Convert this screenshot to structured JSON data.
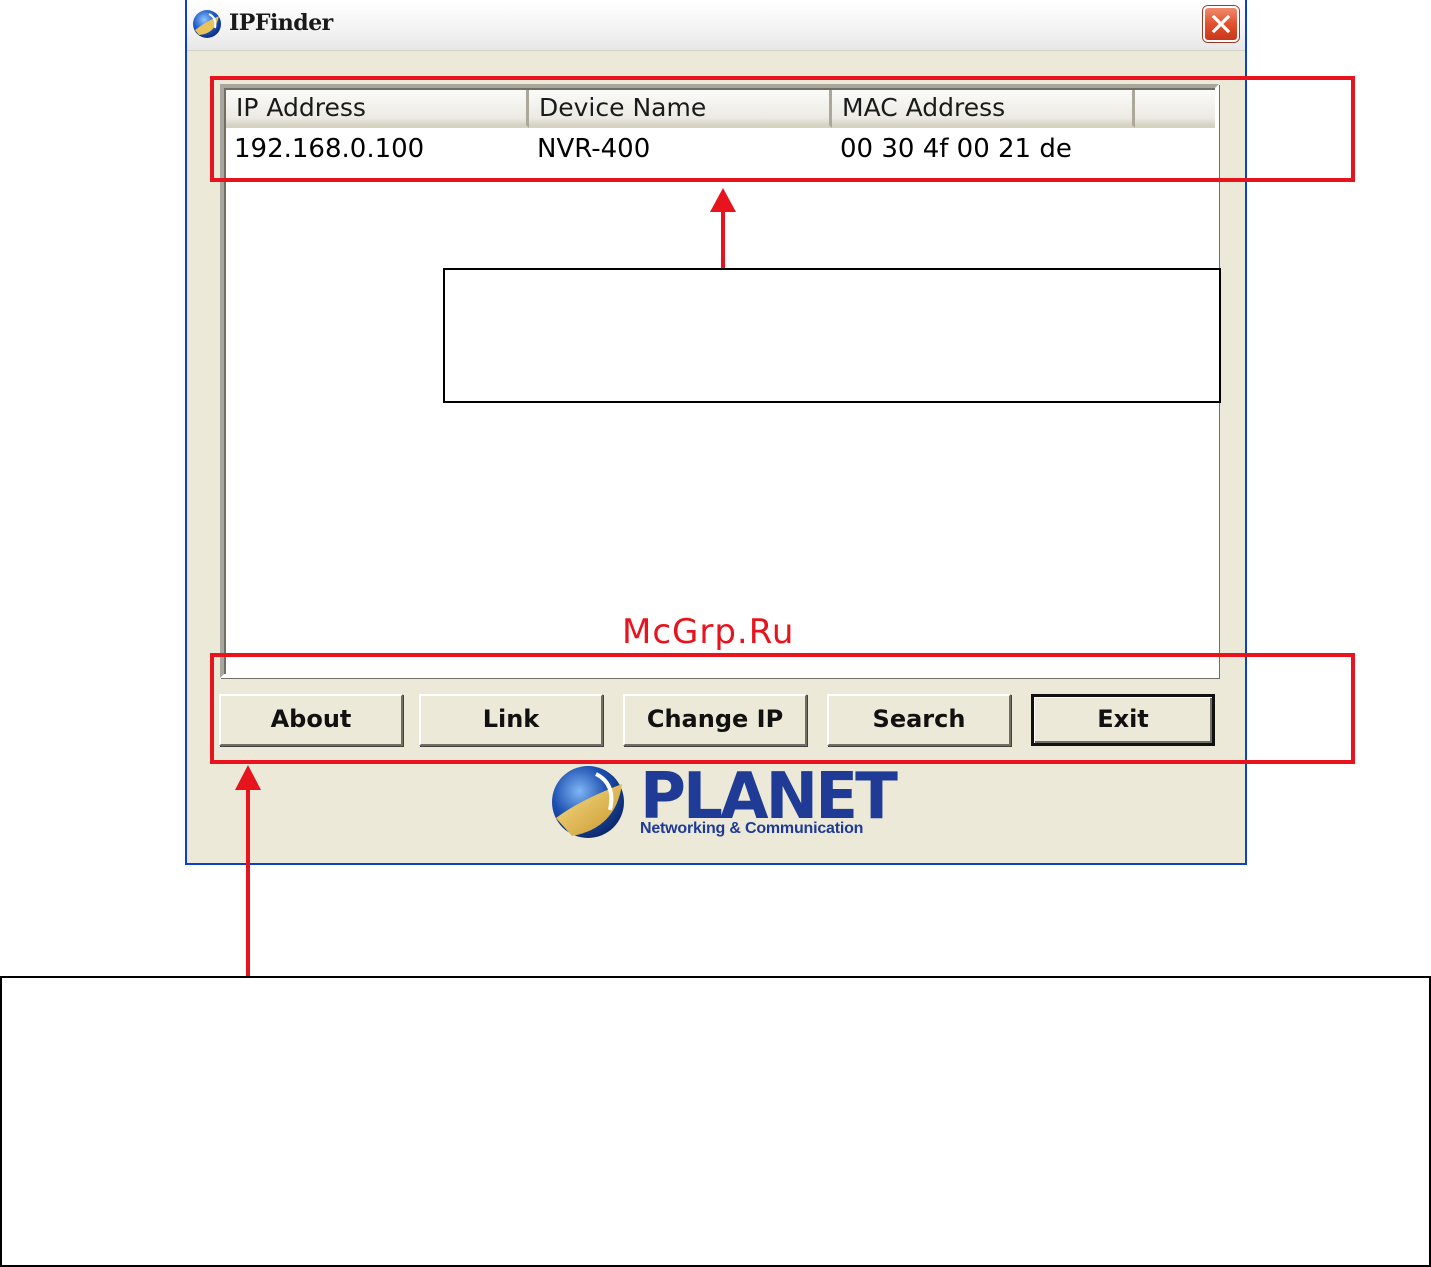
{
  "window": {
    "title": "IPFinder"
  },
  "listview": {
    "columns": [
      "IP Address",
      "Device Name",
      "MAC Address",
      ""
    ],
    "rows": [
      {
        "ip": "192.168.0.100",
        "device_name": "NVR-400",
        "mac": "00 30 4f 00 21 de"
      }
    ]
  },
  "buttons": {
    "about": "About",
    "link": "Link",
    "change_ip": "Change IP",
    "search": "Search",
    "exit": "Exit"
  },
  "logo": {
    "word": "PLANET",
    "tagline": "Networking & Communication"
  },
  "watermark": "McGrp.Ru",
  "colors": {
    "window_bg": "#ece9d8",
    "window_border": "#0a3fcf",
    "annotation_red": "#e8141d",
    "logo_blue": "#1f3b95"
  }
}
